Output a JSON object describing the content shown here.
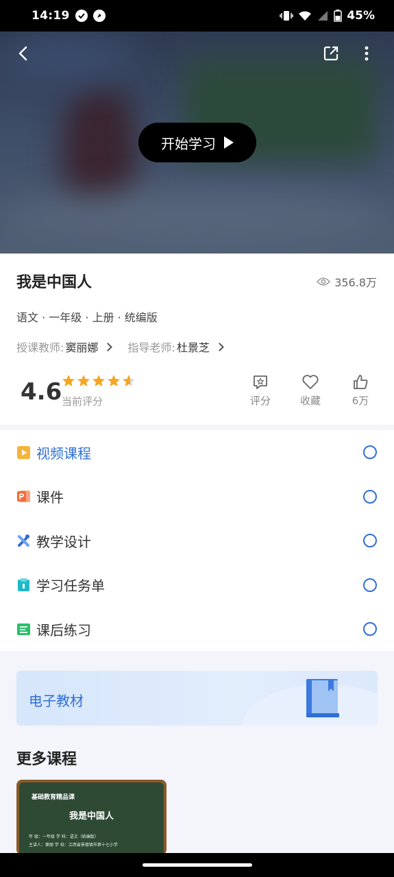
{
  "status_bar": {
    "time": "14:19",
    "battery": "45%"
  },
  "video": {
    "start_label": "开始学习"
  },
  "course": {
    "title": "我是中国人",
    "views": "356.8万",
    "meta": "语文 · 一年级 · 上册 · 统编版",
    "teacher_label": "授课教师:",
    "teacher_name": "窦丽娜",
    "advisor_label": "指导老师:",
    "advisor_name": "杜景芝",
    "rating": "4.6",
    "rating_stars": 4.6,
    "rating_label": "当前评分",
    "actions": {
      "rate": "评分",
      "favorite": "收藏",
      "likes": "6万"
    }
  },
  "resources": [
    {
      "label": "视频课程",
      "icon": "video-icon",
      "color": "#f5b53a",
      "active": true
    },
    {
      "label": "课件",
      "icon": "slides-icon",
      "color": "#f26b3a",
      "active": false
    },
    {
      "label": "教学设计",
      "icon": "design-icon",
      "color": "#2f6fd6",
      "active": false
    },
    {
      "label": "学习任务单",
      "icon": "clipboard-icon",
      "color": "#1fb8c6",
      "active": false
    },
    {
      "label": "课后练习",
      "icon": "exercise-icon",
      "color": "#2bbf6a",
      "active": false
    }
  ],
  "ebook": {
    "label": "电子教材",
    "icon": "book-icon"
  },
  "more": {
    "title": "更多课程",
    "card": {
      "brand": "基础教育精品课",
      "title": "我是中国人",
      "line1": "年  级：一年级          学  科：语文（统编版）",
      "line2": "主讲人：窦丽          学  校：江西省景德镇市第十七小学"
    }
  },
  "colors": {
    "accent": "#2f6fd6",
    "star": "#f5a623"
  }
}
